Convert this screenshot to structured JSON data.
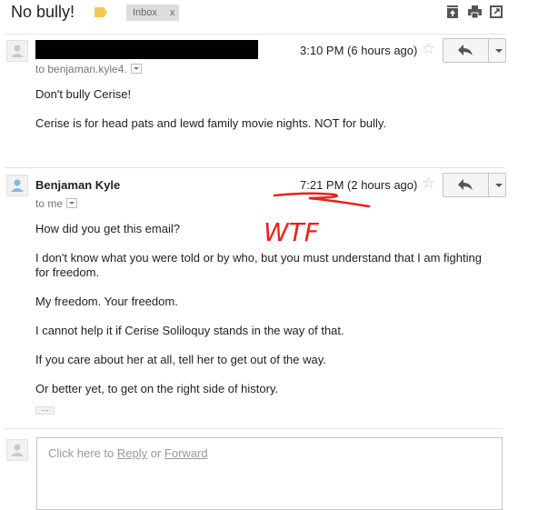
{
  "thread": {
    "subject": "No bully!",
    "label": "Inbox",
    "label_close": "x"
  },
  "messages": [
    {
      "sender": "",
      "time": "3:10 PM (6 hours ago)",
      "to": "to benjaman.kyle4.",
      "body": [
        "Don't bully Cerise!",
        "Cerise is for head pats and lewd family movie nights. NOT for bully."
      ]
    },
    {
      "sender": "Benjaman Kyle",
      "time": "7:21 PM (2 hours ago)",
      "to": "to me",
      "body": [
        "How did you get this email?",
        "I don't know what you were told or by who, but you must understand that I am fighting",
        "for freedom.",
        "My freedom. Your freedom.",
        "I cannot help it if Cerise Soliloquy stands in the way of that.",
        "If you care about her at all, tell her to get out of the way.",
        "Or better yet, to get on the right side of history."
      ],
      "annotation": "WTF",
      "annotation_color": "#e8221a"
    }
  ],
  "reply_box": {
    "prefix": "Click here to ",
    "reply": "Reply",
    "or": " or ",
    "forward": "Forward"
  },
  "more_dots": "…",
  "star": "☆",
  "icons": {
    "archive": "archive-icon",
    "print": "print-icon",
    "popout": "new-window-icon"
  }
}
